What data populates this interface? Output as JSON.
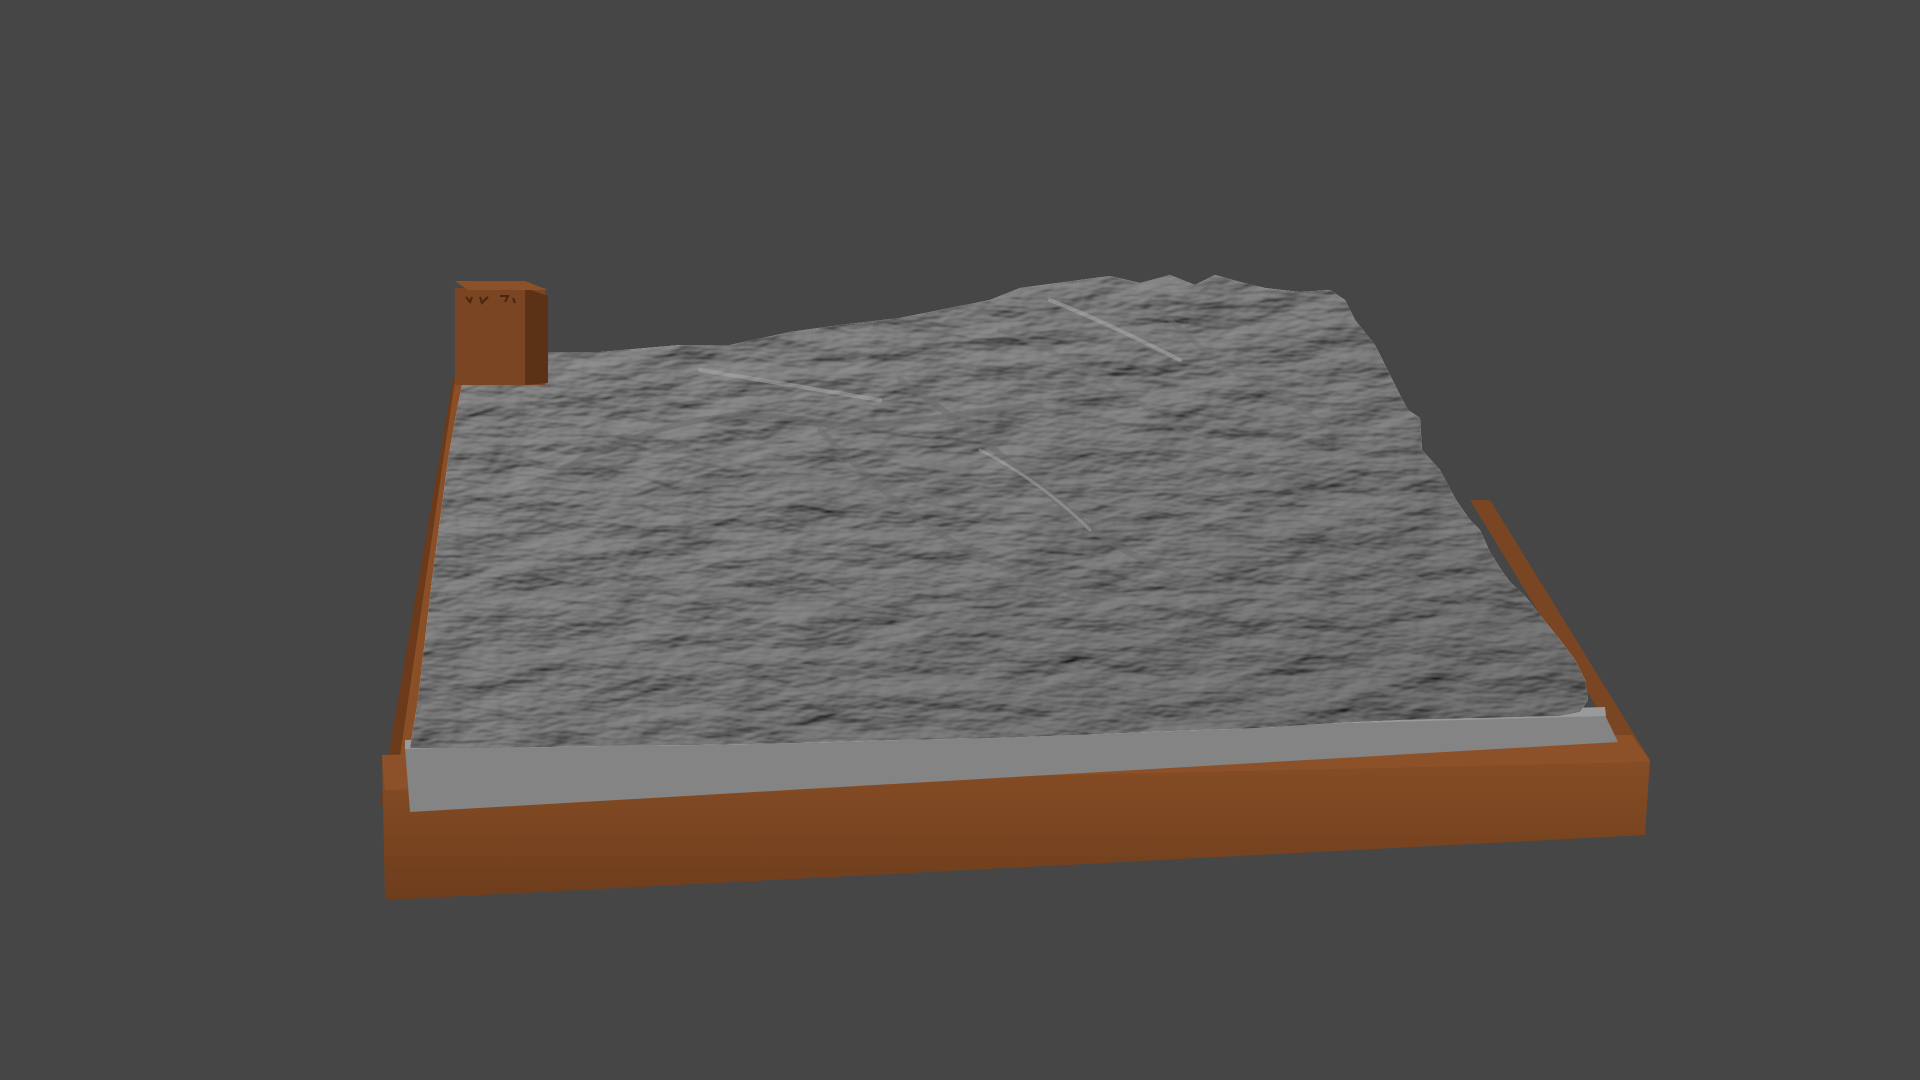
{
  "viewport": {
    "background_color": "#464646"
  },
  "model": {
    "type": "3d-terrain-relief-model",
    "terrain_color": "#8f8f8f",
    "terrain_shadow_color": "#6a6a6a",
    "terrain_highlight_color": "#b4b4b4",
    "base_color": "#7a4522",
    "base_dark_color": "#5c3217",
    "base_light_color": "#8c5128",
    "insert_side_color": "#848484"
  },
  "icons": [
    "terrain-model-icon",
    "north-arrow-icon"
  ]
}
